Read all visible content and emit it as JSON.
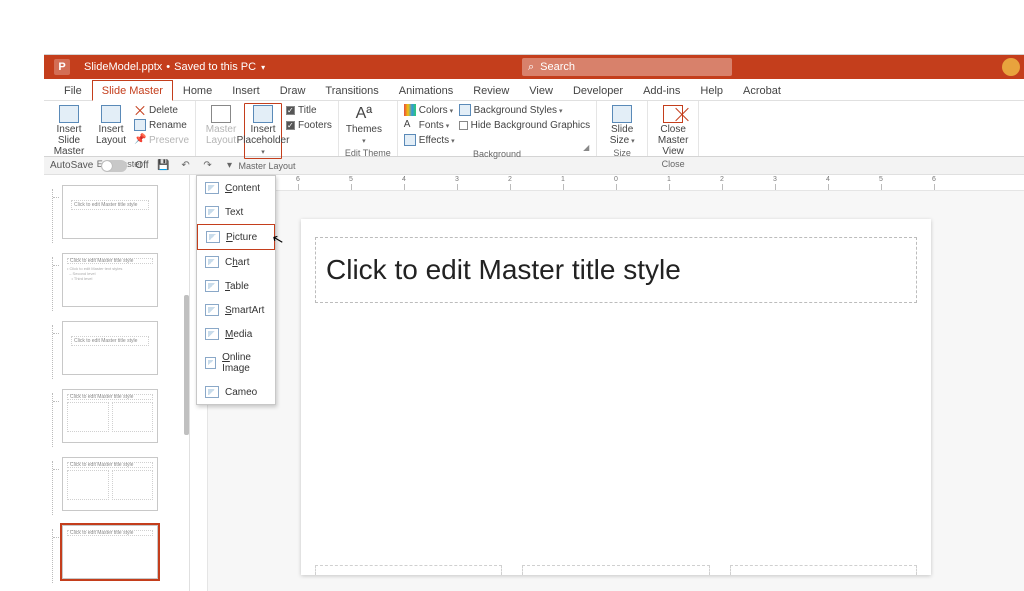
{
  "title": {
    "filename": "SlideModel.pptx",
    "saved": "Saved to this PC"
  },
  "search": {
    "placeholder": "Search"
  },
  "tabs": [
    "File",
    "Slide Master",
    "Home",
    "Insert",
    "Draw",
    "Transitions",
    "Animations",
    "Review",
    "View",
    "Developer",
    "Add-ins",
    "Help",
    "Acrobat"
  ],
  "active_tab": "Slide Master",
  "ribbon": {
    "edit_master": {
      "insert_slide_master": "Insert Slide\nMaster",
      "insert_layout": "Insert\nLayout",
      "delete": "Delete",
      "rename": "Rename",
      "preserve": "Preserve",
      "label": "Edit Master"
    },
    "master_layout": {
      "master_layout": "Master\nLayout",
      "insert_placeholder": "Insert\nPlaceholder",
      "title": "Title",
      "footers": "Footers",
      "label": "Master Layout"
    },
    "edit_theme": {
      "themes": "Themes",
      "label": "Edit Theme"
    },
    "background": {
      "colors": "Colors",
      "fonts": "Fonts",
      "effects": "Effects",
      "bg_styles": "Background Styles",
      "hide_bg": "Hide Background Graphics",
      "label": "Background"
    },
    "size": {
      "slide_size": "Slide\nSize",
      "label": "Size"
    },
    "close": {
      "close": "Close\nMaster View",
      "label": "Close"
    }
  },
  "qat": {
    "autosave": "AutoSave",
    "off": "Off"
  },
  "placeholder_menu": {
    "items": [
      {
        "label": "Content",
        "accel": "C"
      },
      {
        "label": "Text",
        "accel": ""
      },
      {
        "label": "Picture",
        "accel": "P",
        "selected": true
      },
      {
        "label": "Chart",
        "accel": "H"
      },
      {
        "label": "Table",
        "accel": "T"
      },
      {
        "label": "SmartArt",
        "accel": "S"
      },
      {
        "label": "Media",
        "accel": "M"
      },
      {
        "label": "Online Image",
        "accel": "O"
      },
      {
        "label": "Cameo",
        "accel": ""
      }
    ]
  },
  "slide": {
    "title_placeholder": "Click to edit Master title style"
  },
  "thumbs": {
    "alt": "Click to edit Master title style",
    "ruler_ticks": [
      "6",
      "5",
      "4",
      "3",
      "2",
      "1",
      "0",
      "1",
      "2",
      "3",
      "4",
      "5",
      "6"
    ]
  }
}
